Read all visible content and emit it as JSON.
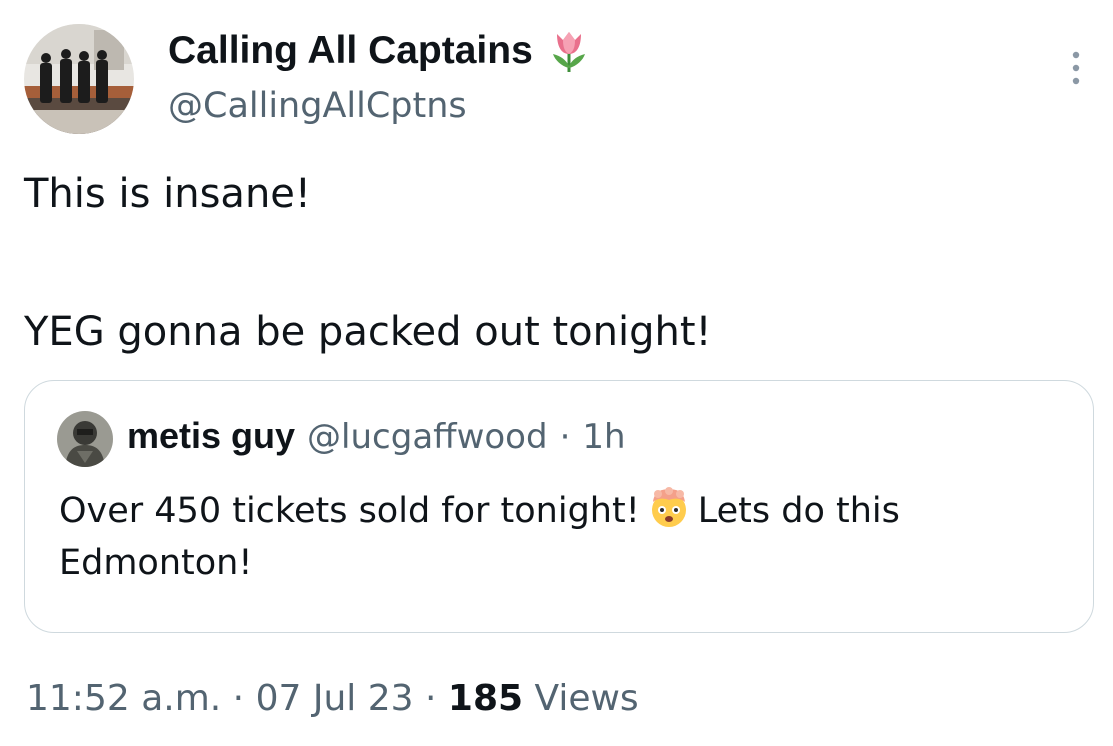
{
  "author": {
    "display_name": "Calling All Captains",
    "handle": "@CallingAllCptns",
    "badge_icon": "tulip-icon",
    "avatar_icon": "band-photo-avatar"
  },
  "tweet": {
    "line1": "This is insane!",
    "line2": "YEG gonna be packed out tonight!"
  },
  "quote": {
    "name": "metis guy",
    "handle": "@lucgaffwood",
    "separator": "·",
    "time": "1h",
    "text_before": "Over 450 tickets sold for tonight!",
    "emoji_icon": "exploding-head-icon",
    "text_after": "Lets do this Edmonton!"
  },
  "meta": {
    "time": "11:52 a.m.",
    "sep1": "·",
    "date": "07 Jul 23",
    "sep2": "·",
    "views_count": "185",
    "views_label": "Views"
  },
  "colors": {
    "text_primary": "#0f1419",
    "text_secondary": "#536471",
    "border": "#cfd9de"
  }
}
